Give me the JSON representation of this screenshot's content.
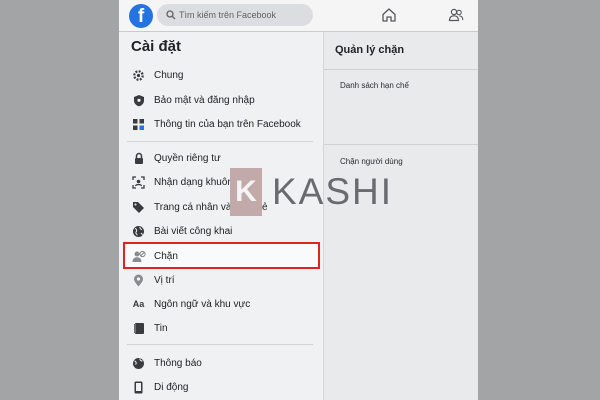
{
  "header": {
    "logo_letter": "f",
    "search_placeholder": "Tìm kiếm trên Facebook",
    "icons": [
      "facebook-logo",
      "search-icon",
      "home-icon",
      "friends-icon"
    ]
  },
  "settings": {
    "title": "Cài đặt",
    "items": [
      {
        "label": "Chung",
        "icon": "gear-icon"
      },
      {
        "label": "Bảo mật và đăng nhập",
        "icon": "shield-icon"
      },
      {
        "label": "Thông tin của bạn trên Facebook",
        "icon": "facebook-grid-icon"
      },
      {
        "label": "Quyền riêng tư",
        "icon": "lock-icon"
      },
      {
        "label": "Nhận dạng khuôn mặt",
        "icon": "face-recognition-icon"
      },
      {
        "label": "Trang cá nhân và gắn thẻ",
        "icon": "tag-icon"
      },
      {
        "label": "Bài viết công khai",
        "icon": "globe-icon"
      },
      {
        "label": "Chặn",
        "icon": "block-user-icon",
        "selected": true
      },
      {
        "label": "Vị trí",
        "icon": "location-pin-icon"
      },
      {
        "label": "Ngôn ngữ và khu vực",
        "icon": "language-icon"
      },
      {
        "label": "Tin",
        "icon": "book-icon"
      },
      {
        "label": "Thông báo",
        "icon": "globe-bell-icon"
      },
      {
        "label": "Di động",
        "icon": "mobile-icon"
      }
    ]
  },
  "block_panel": {
    "title": "Quản lý chặn",
    "restricted_list": "Danh sách hạn chế",
    "block_users": "Chặn người dùng"
  },
  "watermark": {
    "box_letter": "K",
    "text": "KASHI"
  },
  "colors": {
    "highlight_border": "#e0231e",
    "facebook_blue": "#2374e1",
    "overlay": "#a3a4a6"
  }
}
